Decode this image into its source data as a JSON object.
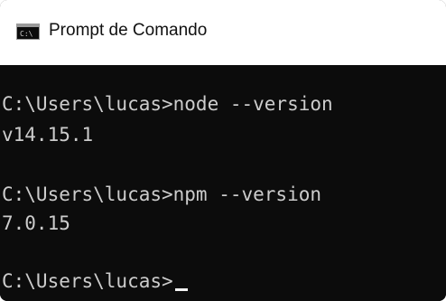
{
  "window": {
    "title": "Prompt de Comando",
    "icon": "cmd-icon"
  },
  "console": {
    "lines": [
      "",
      "C:\\Users\\lucas>node --version",
      "v14.15.1",
      "",
      "C:\\Users\\lucas>npm --version",
      "7.0.15",
      "",
      "C:\\Users\\lucas>"
    ]
  },
  "colors": {
    "console_background": "#0c0c0c",
    "console_text": "#cccccc",
    "titlebar_background": "#ffffff"
  }
}
